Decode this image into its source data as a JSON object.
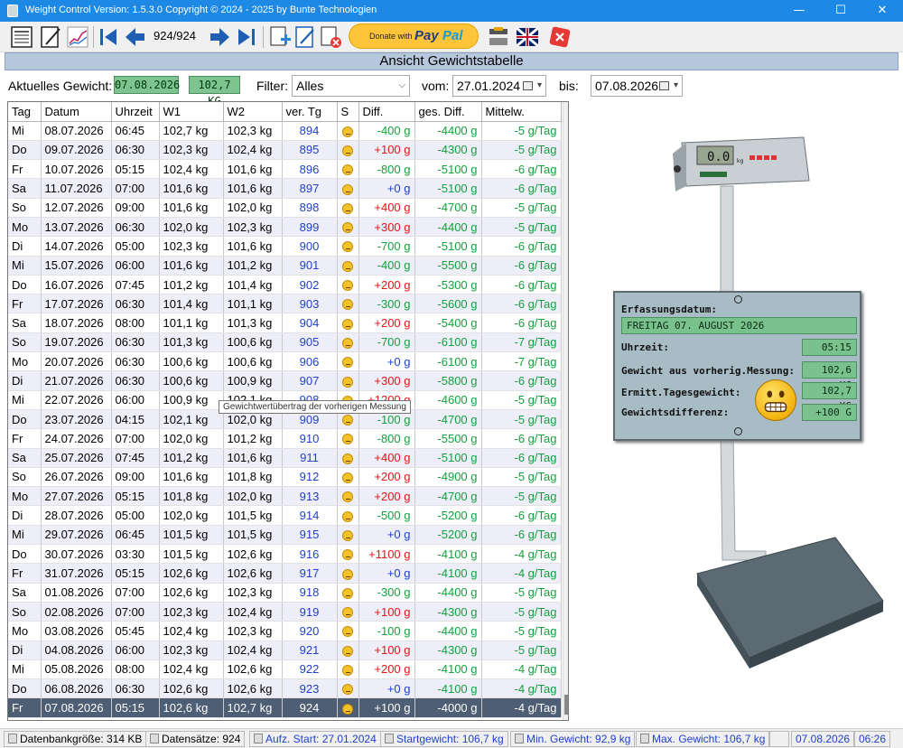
{
  "window": {
    "title": "Weight Control Version: 1.5.3.0 Copyright ©  2024 - 2025 by Bunte Technologien",
    "minimize": "—",
    "maximize": "☐",
    "close": "✕"
  },
  "toolbar": {
    "counter": "924/924",
    "donate_label": "Donate with",
    "paypal_1": "Pay",
    "paypal_2": "Pal"
  },
  "header": {
    "title": "Ansicht Gewichtstabelle"
  },
  "filter": {
    "current_weight_label": "Aktuelles Gewicht:",
    "current_date": "07.08.2026",
    "current_weight": "102,7 KG",
    "filter_label": "Filter:",
    "filter_value": "Alles",
    "from_label": "vom:",
    "from_date": "27.01.2024",
    "to_label": "bis:",
    "to_date": "07.08.2026"
  },
  "table": {
    "columns": [
      "Tag",
      "Datum",
      "Uhrzeit",
      "W1",
      "W2",
      "ver. Tg",
      "S",
      "Diff.",
      "ges. Diff.",
      "Mittelw."
    ],
    "rows": [
      [
        "Mi",
        "08.07.2026",
        "06:45",
        "102,7 kg",
        "102,3 kg",
        "894",
        "-400 g",
        "-4400 g",
        "-5 g/Tag"
      ],
      [
        "Do",
        "09.07.2026",
        "06:30",
        "102,3 kg",
        "102,4 kg",
        "895",
        "+100 g",
        "-4300 g",
        "-5 g/Tag"
      ],
      [
        "Fr",
        "10.07.2026",
        "05:15",
        "102,4 kg",
        "101,6 kg",
        "896",
        "-800 g",
        "-5100 g",
        "-6 g/Tag"
      ],
      [
        "Sa",
        "11.07.2026",
        "07:00",
        "101,6 kg",
        "101,6 kg",
        "897",
        "+0 g",
        "-5100 g",
        "-6 g/Tag"
      ],
      [
        "So",
        "12.07.2026",
        "09:00",
        "101,6 kg",
        "102,0 kg",
        "898",
        "+400 g",
        "-4700 g",
        "-5 g/Tag"
      ],
      [
        "Mo",
        "13.07.2026",
        "06:30",
        "102,0 kg",
        "102,3 kg",
        "899",
        "+300 g",
        "-4400 g",
        "-5 g/Tag"
      ],
      [
        "Di",
        "14.07.2026",
        "05:00",
        "102,3 kg",
        "101,6 kg",
        "900",
        "-700 g",
        "-5100 g",
        "-6 g/Tag"
      ],
      [
        "Mi",
        "15.07.2026",
        "06:00",
        "101,6 kg",
        "101,2 kg",
        "901",
        "-400 g",
        "-5500 g",
        "-6 g/Tag"
      ],
      [
        "Do",
        "16.07.2026",
        "07:45",
        "101,2 kg",
        "101,4 kg",
        "902",
        "+200 g",
        "-5300 g",
        "-6 g/Tag"
      ],
      [
        "Fr",
        "17.07.2026",
        "06:30",
        "101,4 kg",
        "101,1 kg",
        "903",
        "-300 g",
        "-5600 g",
        "-6 g/Tag"
      ],
      [
        "Sa",
        "18.07.2026",
        "08:00",
        "101,1 kg",
        "101,3 kg",
        "904",
        "+200 g",
        "-5400 g",
        "-6 g/Tag"
      ],
      [
        "So",
        "19.07.2026",
        "06:30",
        "101,3 kg",
        "100,6 kg",
        "905",
        "-700 g",
        "-6100 g",
        "-7 g/Tag"
      ],
      [
        "Mo",
        "20.07.2026",
        "06:30",
        "100,6 kg",
        "100,6 kg",
        "906",
        "+0 g",
        "-6100 g",
        "-7 g/Tag"
      ],
      [
        "Di",
        "21.07.2026",
        "06:30",
        "100,6 kg",
        "100,9 kg",
        "907",
        "+300 g",
        "-5800 g",
        "-6 g/Tag"
      ],
      [
        "Mi",
        "22.07.2026",
        "06:00",
        "100,9 kg",
        "102,1 kg",
        "908",
        "+1200 g",
        "-4600 g",
        "-5 g/Tag"
      ],
      [
        "Do",
        "23.07.2026",
        "04:15",
        "102,1 kg",
        "102,0 kg",
        "909",
        "-100 g",
        "-4700 g",
        "-5 g/Tag"
      ],
      [
        "Fr",
        "24.07.2026",
        "07:00",
        "102,0 kg",
        "101,2 kg",
        "910",
        "-800 g",
        "-5500 g",
        "-6 g/Tag"
      ],
      [
        "Sa",
        "25.07.2026",
        "07:45",
        "101,2 kg",
        "101,6 kg",
        "911",
        "+400 g",
        "-5100 g",
        "-6 g/Tag"
      ],
      [
        "So",
        "26.07.2026",
        "09:00",
        "101,6 kg",
        "101,8 kg",
        "912",
        "+200 g",
        "-4900 g",
        "-5 g/Tag"
      ],
      [
        "Mo",
        "27.07.2026",
        "05:15",
        "101,8 kg",
        "102,0 kg",
        "913",
        "+200 g",
        "-4700 g",
        "-5 g/Tag"
      ],
      [
        "Di",
        "28.07.2026",
        "05:00",
        "102,0 kg",
        "101,5 kg",
        "914",
        "-500 g",
        "-5200 g",
        "-6 g/Tag"
      ],
      [
        "Mi",
        "29.07.2026",
        "06:45",
        "101,5 kg",
        "101,5 kg",
        "915",
        "+0 g",
        "-5200 g",
        "-6 g/Tag"
      ],
      [
        "Do",
        "30.07.2026",
        "03:30",
        "101,5 kg",
        "102,6 kg",
        "916",
        "+1100 g",
        "-4100 g",
        "-4 g/Tag"
      ],
      [
        "Fr",
        "31.07.2026",
        "05:15",
        "102,6 kg",
        "102,6 kg",
        "917",
        "+0 g",
        "-4100 g",
        "-4 g/Tag"
      ],
      [
        "Sa",
        "01.08.2026",
        "07:00",
        "102,6 kg",
        "102,3 kg",
        "918",
        "-300 g",
        "-4400 g",
        "-5 g/Tag"
      ],
      [
        "So",
        "02.08.2026",
        "07:00",
        "102,3 kg",
        "102,4 kg",
        "919",
        "+100 g",
        "-4300 g",
        "-5 g/Tag"
      ],
      [
        "Mo",
        "03.08.2026",
        "05:45",
        "102,4 kg",
        "102,3 kg",
        "920",
        "-100 g",
        "-4400 g",
        "-5 g/Tag"
      ],
      [
        "Di",
        "04.08.2026",
        "06:00",
        "102,3 kg",
        "102,4 kg",
        "921",
        "+100 g",
        "-4300 g",
        "-5 g/Tag"
      ],
      [
        "Mi",
        "05.08.2026",
        "08:00",
        "102,4 kg",
        "102,6 kg",
        "922",
        "+200 g",
        "-4100 g",
        "-4 g/Tag"
      ],
      [
        "Do",
        "06.08.2026",
        "06:30",
        "102,6 kg",
        "102,6 kg",
        "923",
        "+0 g",
        "-4100 g",
        "-4 g/Tag"
      ],
      [
        "Fr",
        "07.08.2026",
        "05:15",
        "102,6 kg",
        "102,7 kg",
        "924",
        "+100 g",
        "-4000 g",
        "-4 g/Tag"
      ]
    ],
    "selected_row": 30,
    "tooltip": "Gewichtwertübertrag der vorherigen Messung"
  },
  "panel": {
    "date_label": "Erfassungsdatum:",
    "date_value": "FREITAG 07. AUGUST 2026",
    "time_label": "Uhrzeit:",
    "time_value": "05:15",
    "prev_label": "Gewicht aus vorherig.Messung:",
    "prev_value": "102,6 KG",
    "day_label": "Ermitt.Tagesgewicht:",
    "day_value": "102,7 KG",
    "diff_label": "Gewichtsdifferenz:",
    "diff_value": "+100 G"
  },
  "scale_display": {
    "value": "0.0",
    "unit": "kg"
  },
  "status": {
    "db_size": "Datenbankgröße: 314 KB",
    "records": "Datensätze: 924",
    "start": "Aufz. Start: 27.01.2024",
    "start_weight": "Startgewicht: 106,7 kg",
    "min_weight": "Min. Gewicht: 92,9 kg",
    "max_weight": "Max. Gewicht: 106,7 kg",
    "date": "07.08.2026",
    "time": "06:26"
  },
  "colors": {
    "titlebar": "#1e88e5",
    "lcd_green": "#7dc48f",
    "selected_row": "#4e5e74",
    "positive": "#e01515",
    "negative": "#12a23b",
    "neutral": "#1f3fcf"
  }
}
